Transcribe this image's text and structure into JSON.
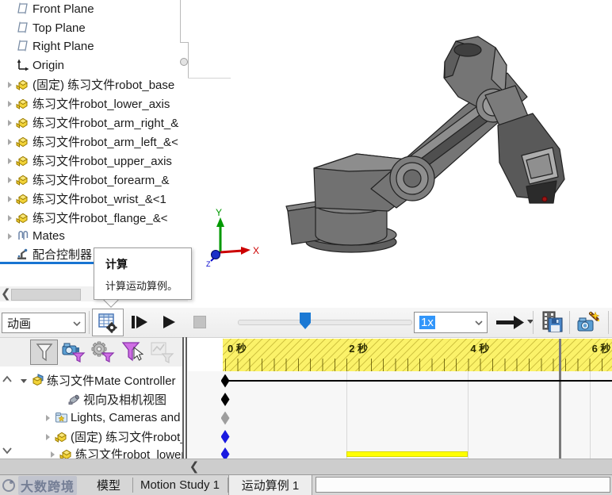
{
  "feature_tree": {
    "items": [
      {
        "label": "Front Plane",
        "icon": "plane-icon"
      },
      {
        "label": "Top Plane",
        "icon": "plane-icon"
      },
      {
        "label": "Right Plane",
        "icon": "plane-icon"
      },
      {
        "label": "Origin",
        "icon": "origin-icon"
      },
      {
        "label": "(固定) 练习文件robot_base",
        "icon": "part-icon"
      },
      {
        "label": "练习文件robot_lower_axis",
        "icon": "part-icon"
      },
      {
        "label": "练习文件robot_arm_right_&",
        "icon": "part-icon"
      },
      {
        "label": "练习文件robot_arm_left_&<",
        "icon": "part-icon"
      },
      {
        "label": "练习文件robot_upper_axis",
        "icon": "part-icon"
      },
      {
        "label": "练习文件robot_forearm_&",
        "icon": "part-icon"
      },
      {
        "label": "练习文件robot_wrist_&<1",
        "icon": "part-icon"
      },
      {
        "label": "练习文件robot_flange_&<",
        "icon": "part-icon"
      },
      {
        "label": "Mates",
        "icon": "mates-icon"
      },
      {
        "label": "配合控制器",
        "icon": "mate-controller-icon"
      }
    ]
  },
  "tooltip": {
    "title": "计算",
    "description": "计算运动算例。"
  },
  "motion_toolbar": {
    "study_type_value": "动画",
    "speed_value": "1x",
    "slider_fraction": 0.39,
    "accent_blue": "#1b79d4"
  },
  "icons": {
    "calculate": "table-with-gear",
    "play-from-start": "bar-and-triangle",
    "play": "triangle",
    "stop": "gray-square-disabled",
    "playback-mode": "black-arrow-with-dropdown",
    "save-animation": "filmstrip-floppy",
    "animation-wizard": "camera-magic-wand",
    "filter-all": "funnel",
    "filter-animated": "camera-funnel",
    "filter-driving": "gear-funnel",
    "filter-selected": "funnel-cursor",
    "filter-results": "chart-funnel-disabled"
  },
  "timeline": {
    "ruler_labels": [
      {
        "t": 0,
        "text": "0 秒"
      },
      {
        "t": 2,
        "text": "2 秒"
      },
      {
        "t": 4,
        "text": "4 秒"
      },
      {
        "t": 6,
        "text": "6 秒"
      }
    ],
    "gridline_times": [
      2,
      4,
      6
    ],
    "end_marker_time": 5.5,
    "ruler_color": "#fbf269",
    "rows": [
      {
        "label": "练习文件Mate Controller",
        "icon": "assembly-icon",
        "key_time": 0,
        "key_color": "#000000",
        "has_duration_line": true
      },
      {
        "label": "视向及相机视图",
        "icon": "view-orientation-icon",
        "key_time": 0,
        "key_color": "#000000"
      },
      {
        "label": "Lights, Cameras and Scene",
        "icon": "lights-folder-icon",
        "key_time": 0,
        "key_color": "#9e9e9e"
      },
      {
        "label": "(固定) 练习文件robot_base",
        "icon": "part-icon",
        "key_time": 0,
        "key_color": "#1a1ae0"
      },
      {
        "label": "练习文件robot_lower_axis",
        "icon": "part-icon",
        "key_time": 0,
        "key_color": "#1a1ae0",
        "bar": {
          "start": 2,
          "end": 4,
          "color": "#ffff00"
        }
      }
    ]
  },
  "triad": {
    "x_label": "X",
    "y_label": "Y",
    "z_label": "Z",
    "x_color": "#cc0000",
    "y_color": "#009900",
    "z_color": "#0000cc"
  },
  "tab_bar": {
    "watermark": "大数跨境",
    "tabs": [
      {
        "label": "模型"
      },
      {
        "label": "Motion Study 1"
      },
      {
        "label": "运动算例 1"
      }
    ],
    "active_tab": "运动算例 1"
  }
}
